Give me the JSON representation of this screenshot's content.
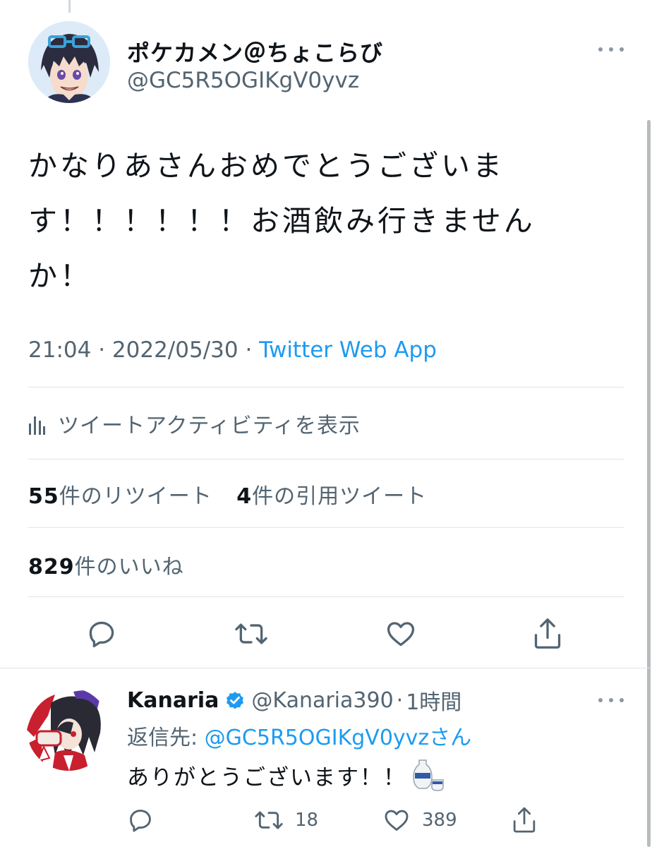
{
  "tweet": {
    "author_name": "ポケカメン＠ちょこらび",
    "author_handle": "@GC5R5OGIKgV0yvz",
    "text": "かなりあさんおめでとうございます！！！！！！お酒飲み行きませんか！",
    "time": "21:04",
    "date": "2022/05/30",
    "separator": " · ",
    "source": "Twitter Web App",
    "activity_label": "ツイートアクティビティを表示",
    "retweets_count": "55",
    "retweets_label": "件のリツイート",
    "quotes_count": "4",
    "quotes_label": "件の引用ツイート",
    "likes_count": "829",
    "likes_label": "件のいいね",
    "actions": [
      "reply-icon",
      "retweet-icon",
      "like-icon",
      "share-icon"
    ]
  },
  "reply": {
    "author_name": "Kanaria",
    "author_handle": "@Kanaria390",
    "dot": "·",
    "time": "1時間",
    "reply_to_label": "返信先: ",
    "reply_to_handle": "@GC5R5OGIKgV0yvz",
    "reply_to_suffix": "さん",
    "text": "ありがとうございます！！",
    "emoji": "sake-icon",
    "retweets": "18",
    "likes": "389"
  },
  "colors": {
    "text": "#0f1419",
    "secondary": "#536471",
    "accent": "#1d9bf0",
    "divider": "#dfe5ea"
  }
}
